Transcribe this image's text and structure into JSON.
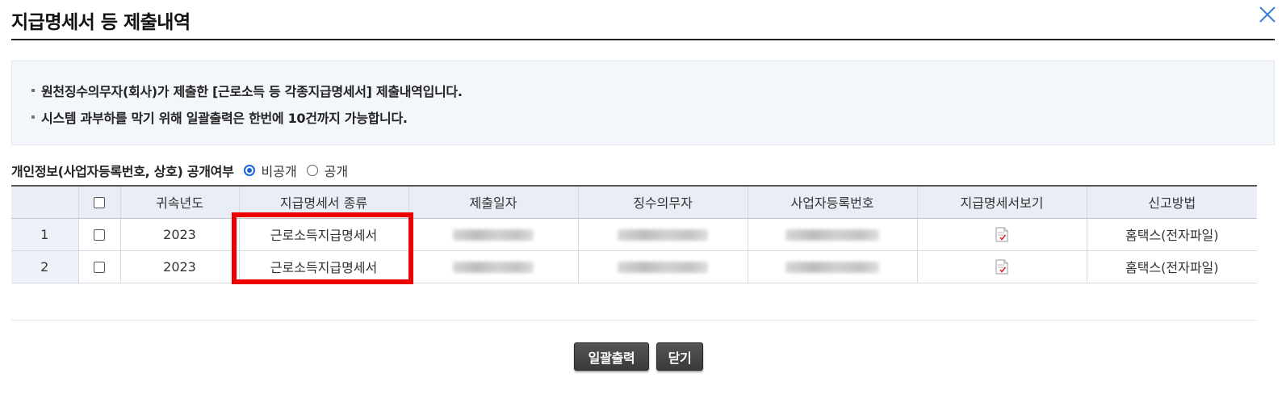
{
  "header": {
    "title": "지급명세서 등 제출내역",
    "close_icon": "close-icon"
  },
  "notice": {
    "lines": [
      "원천징수의무자(회사)가 제출한 [근로소득 등 각종지급명세서] 제출내역입니다.",
      "시스템 과부하를 막기 위해 일괄출력은 한번에 10건까지 가능합니다."
    ]
  },
  "privacy": {
    "label": "개인정보(사업자등록번호, 상호) 공개여부",
    "options": [
      {
        "label": "비공개",
        "selected": true
      },
      {
        "label": "공개",
        "selected": false
      }
    ]
  },
  "table": {
    "columns": [
      "",
      "",
      "귀속년도",
      "지급명세서 종류",
      "제출일자",
      "징수의무자",
      "사업자등록번호",
      "지급명세서보기",
      "신고방법"
    ],
    "rows": [
      {
        "num": "1",
        "year": "2023",
        "type": "근로소득지급명세서",
        "view_icon": "document-icon",
        "method": "홈택스(전자파일)"
      },
      {
        "num": "2",
        "year": "2023",
        "type": "근로소득지급명세서",
        "view_icon": "document-icon",
        "method": "홈택스(전자파일)"
      }
    ]
  },
  "buttons": {
    "print": "일괄출력",
    "close": "닫기"
  },
  "colors": {
    "highlight": "#ee0000",
    "header_bg": "#e9eef6",
    "notice_bg": "#f3f6fa",
    "radio_accent": "#1a66d6",
    "button_bg": "#444444"
  }
}
